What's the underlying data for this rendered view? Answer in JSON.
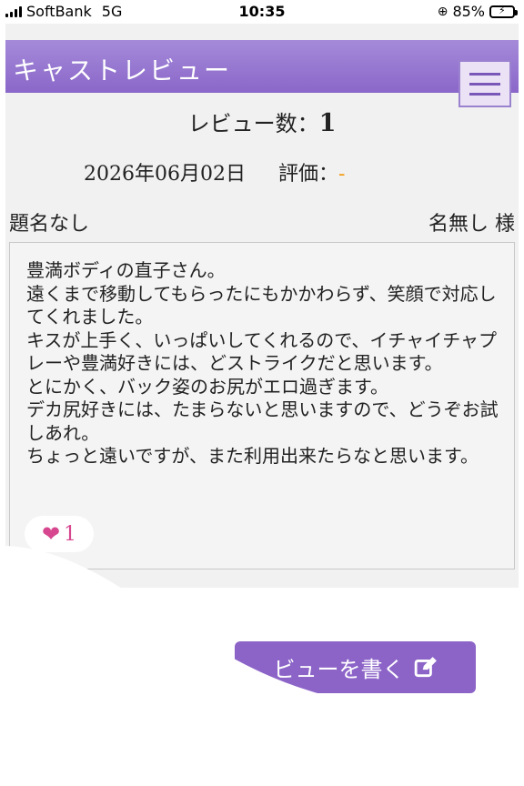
{
  "status_bar": {
    "carrier": "SoftBank",
    "network": "5G",
    "time": "10:35",
    "battery": "85%",
    "battery_color": "#4cd964"
  },
  "header": {
    "title": "キャストレビュー",
    "menu_icon": "hamburger-icon",
    "color": "#8a67c9"
  },
  "summary": {
    "count_label": "レビュー数：",
    "count_value": "1"
  },
  "review": {
    "date": "2026年06月02日",
    "rating_label": "評価：",
    "rating_value": "-",
    "title": "題名なし",
    "reviewer": "名無し 様",
    "body": "豊満ボディの直子さん。\n遠くまで移動してもらったにもかかわらず、笑顔で対応してくれました。\nキスが上手く、いっぱいしてくれるので、イチャイチャプレーや豊満好きには、どストライクだと思います。\nとにかく、バック姿のお尻がエロ過ぎます。\nデカ尻好きには、たまらないと思いますので、どうぞお試しあれ。\nちょっと遠いですが、また利用出来たらなと思います。",
    "likes": "1",
    "like_icon": "heart-icon"
  },
  "write_button": {
    "label": "ビューを書く",
    "icon": "edit-icon"
  }
}
